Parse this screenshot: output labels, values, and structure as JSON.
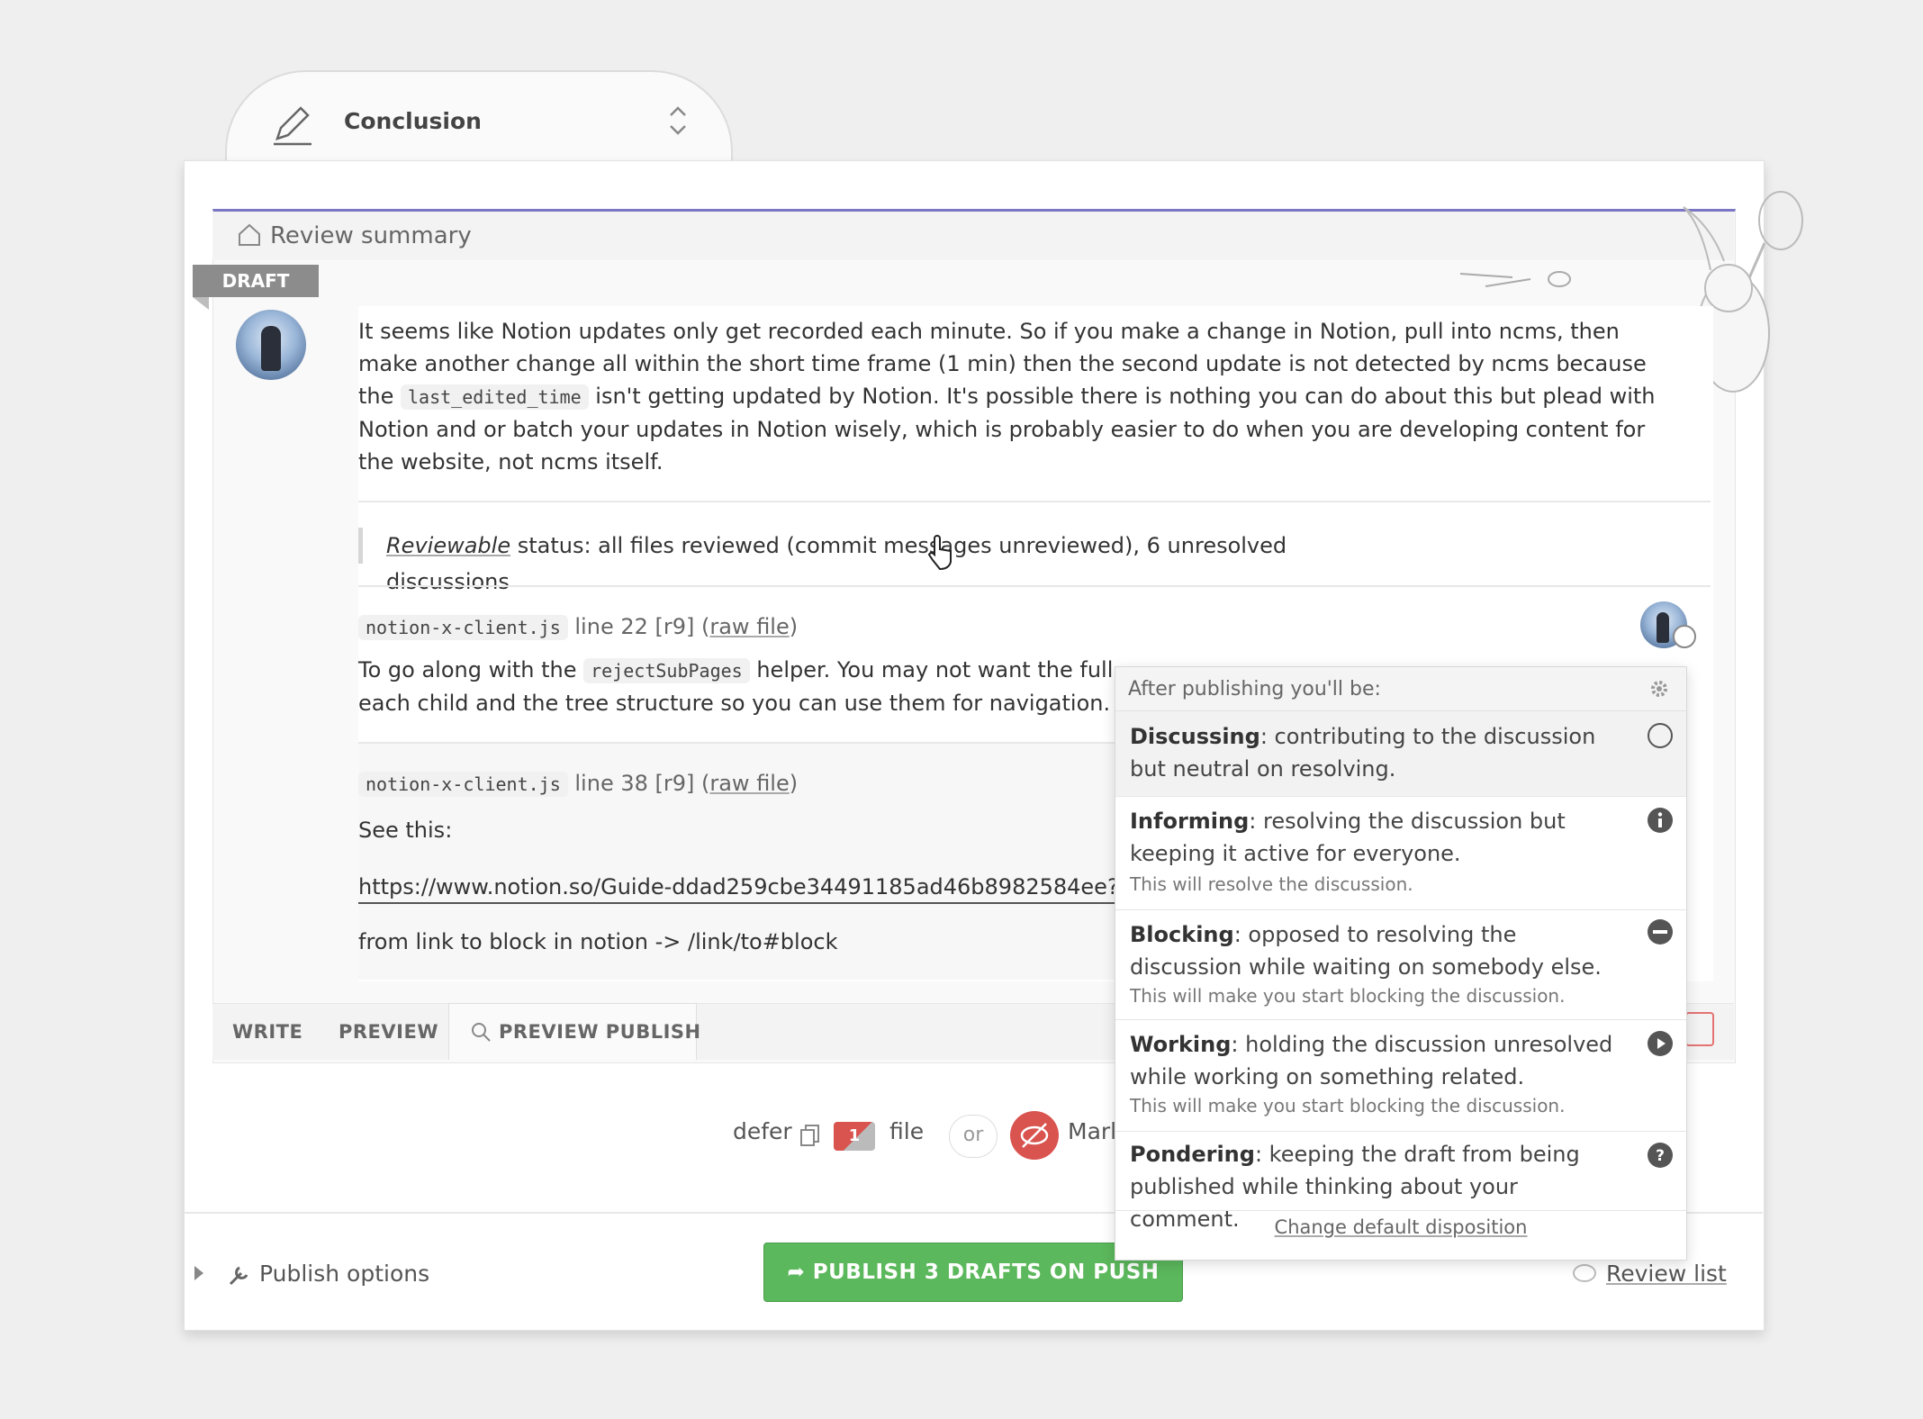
{
  "tab": {
    "title": "Conclusion"
  },
  "panel": {
    "header_title": "Review summary",
    "draft_badge": "DRAFT"
  },
  "summary": {
    "text_a": "It seems like Notion updates only get recorded each minute. So if you make a change in Notion, pull into ncms, then make another change all within the short time frame (1 min) then the second update is not detected by ncms because the ",
    "code": "last_edited_time",
    "text_b": " isn't getting updated by Notion. It's possible there is nothing you can do about this but plead with Notion and or batch your updates in Notion wisely, which is probably easier to do when you are developing content for the website, not ncms itself."
  },
  "status": {
    "reviewable": "Reviewable",
    "text": " status: all files reviewed (commit messages unreviewed), 6 unresolved discussions"
  },
  "comment1": {
    "file": "notion-x-client.js",
    "line": "line 22 [r9] (",
    "raw": "raw file",
    "close": ")",
    "text_a": "To go along with the ",
    "code": "rejectSubPages",
    "text_b": " helper. You may not want the full",
    "text_c": "each child and the tree structure so you can use them for navigation."
  },
  "comment2": {
    "file": "notion-x-client.js",
    "line": "line 38 [r9] (",
    "raw": "raw file",
    "close": ")",
    "text_a": "See this:",
    "url": "https://www.notion.so/Guide-ddad259cbe34491185ad46b8982584ee?pv",
    "text_b": "from link to block in notion -> /link/to#block"
  },
  "editor_tabs": {
    "write": "WRITE",
    "preview": "PREVIEW",
    "preview_publish": "PREVIEW PUBLISH"
  },
  "defer_row": {
    "defer": "defer",
    "count": "1",
    "file": "file",
    "or": "or",
    "mark": "Marl"
  },
  "footer": {
    "publish_options": "Publish options",
    "publish_button": "PUBLISH 3 DRAFTS ON PUSH",
    "review_list": "Review list"
  },
  "popup": {
    "header": "After publishing you'll be:",
    "options": [
      {
        "name": "Discussing",
        "desc": ": contributing to the discussion but neutral on resolving.",
        "sub": "",
        "icon": "circle-outline-icon"
      },
      {
        "name": "Informing",
        "desc": ": resolving the discussion but keeping it active for everyone.",
        "sub": "This will resolve the discussion.",
        "icon": "info-icon"
      },
      {
        "name": "Blocking",
        "desc": ": opposed to resolving the discussion while waiting on somebody else.",
        "sub": "This will make you start blocking the discussion.",
        "icon": "minus-circle-icon"
      },
      {
        "name": "Working",
        "desc": ": holding the discussion unresolved while working on something related.",
        "sub": "This will make you start blocking the discussion.",
        "icon": "play-icon"
      },
      {
        "name": "Pondering",
        "desc": ": keeping the draft from being published while thinking about your comment.",
        "sub": "",
        "icon": "question-icon"
      }
    ],
    "footer": "Change default disposition"
  },
  "colors": {
    "accent": "#7a76c4",
    "publish": "#5cb85c",
    "danger": "#d9534f"
  }
}
